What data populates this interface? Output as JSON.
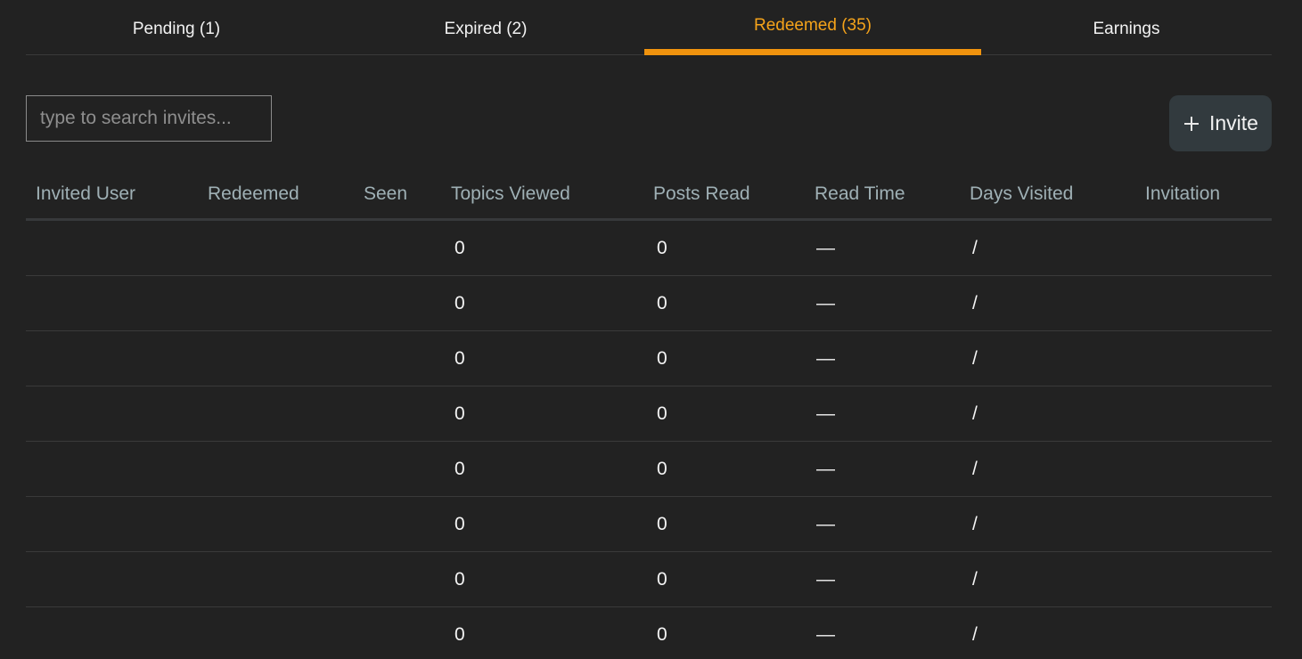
{
  "tabs": [
    {
      "label": "Pending (1)",
      "active": false
    },
    {
      "label": "Expired (2)",
      "active": false
    },
    {
      "label": "Redeemed (35)",
      "active": true
    },
    {
      "label": "Earnings",
      "active": false
    }
  ],
  "colors": {
    "background": "#222222",
    "accent": "#f0930e",
    "header_text": "#9fb0b5",
    "button_bg": "#323a3e"
  },
  "search": {
    "placeholder": "type to search invites...",
    "value": ""
  },
  "invite_button": {
    "icon": "plus-icon",
    "label": "Invite"
  },
  "table": {
    "columns": [
      "Invited User",
      "Redeemed",
      "Seen",
      "Topics Viewed",
      "Posts Read",
      "Read Time",
      "Days Visited",
      "Invitation"
    ],
    "rows": [
      {
        "invited_user": "",
        "redeemed": "",
        "seen": "",
        "topics_viewed": "0",
        "posts_read": "0",
        "read_time": "—",
        "days_visited": "/",
        "invitation": ""
      },
      {
        "invited_user": "",
        "redeemed": "",
        "seen": "",
        "topics_viewed": "0",
        "posts_read": "0",
        "read_time": "—",
        "days_visited": "/",
        "invitation": ""
      },
      {
        "invited_user": "",
        "redeemed": "",
        "seen": "",
        "topics_viewed": "0",
        "posts_read": "0",
        "read_time": "—",
        "days_visited": "/",
        "invitation": ""
      },
      {
        "invited_user": "",
        "redeemed": "",
        "seen": "",
        "topics_viewed": "0",
        "posts_read": "0",
        "read_time": "—",
        "days_visited": "/",
        "invitation": ""
      },
      {
        "invited_user": "",
        "redeemed": "",
        "seen": "",
        "topics_viewed": "0",
        "posts_read": "0",
        "read_time": "—",
        "days_visited": "/",
        "invitation": ""
      },
      {
        "invited_user": "",
        "redeemed": "",
        "seen": "",
        "topics_viewed": "0",
        "posts_read": "0",
        "read_time": "—",
        "days_visited": "/",
        "invitation": ""
      },
      {
        "invited_user": "",
        "redeemed": "",
        "seen": "",
        "topics_viewed": "0",
        "posts_read": "0",
        "read_time": "—",
        "days_visited": "/",
        "invitation": ""
      },
      {
        "invited_user": "",
        "redeemed": "",
        "seen": "",
        "topics_viewed": "0",
        "posts_read": "0",
        "read_time": "—",
        "days_visited": "/",
        "invitation": ""
      }
    ]
  }
}
